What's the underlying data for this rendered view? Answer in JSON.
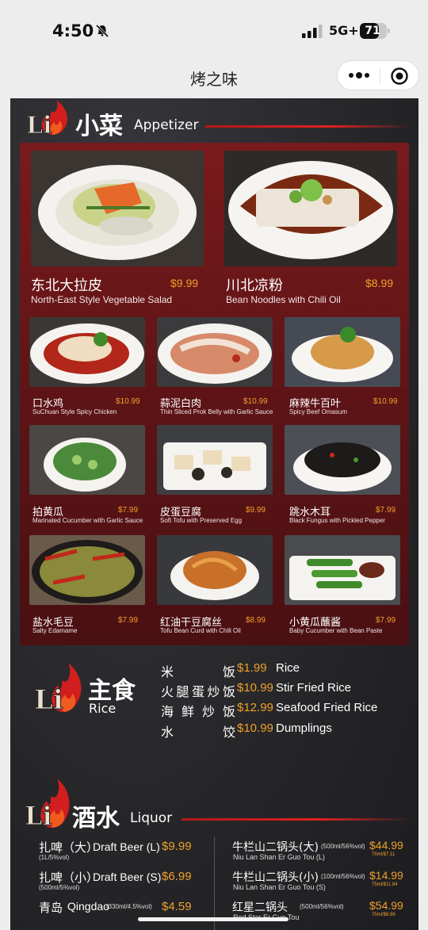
{
  "status_bar": {
    "time": "4:50",
    "network": "5G+",
    "battery": "71"
  },
  "nav": {
    "title": "烤之味"
  },
  "brand": {
    "logo_text": "Li",
    "accent": "#e02020",
    "price_color": "#f0a02a"
  },
  "appetizer": {
    "title_cn": "小菜",
    "title_en": "Appetizer",
    "items": [
      {
        "cn": "东北大拉皮",
        "en": "North-East Style Vegetable Salad",
        "price": "$9.99"
      },
      {
        "cn": "川北凉粉",
        "en": "Bean Noodles with Chili Oil",
        "price": "$8.99"
      },
      {
        "cn": "口水鸡",
        "en": "SuChuan Style Spicy Chicken",
        "price": "$10.99"
      },
      {
        "cn": "蒜泥白肉",
        "en": "Thin Sliced Prok Belly with Garlic Sauce",
        "price": "$10.99"
      },
      {
        "cn": "麻辣牛百叶",
        "en": "Spicy Beef Omasum",
        "price": "$10.99"
      },
      {
        "cn": "拍黄瓜",
        "en": "Marinated Cucumber with Garlic Sauce",
        "price": "$7.99"
      },
      {
        "cn": "皮蛋豆腐",
        "en": "Soft Tofu with Preserved Egg",
        "price": "$9.99"
      },
      {
        "cn": "跳水木耳",
        "en": "Black Fungus with Pickled Pepper",
        "price": "$7.99"
      },
      {
        "cn": "盐水毛豆",
        "en": "Salty Edamame",
        "price": "$7.99"
      },
      {
        "cn": "红油干豆腐丝",
        "en": "Tofu Bean Curd with Chili Oil",
        "price": "$8.99"
      },
      {
        "cn": "小黄瓜蘸酱",
        "en": "Baby Cucumber with Bean Paste",
        "price": "$7.99"
      }
    ]
  },
  "rice": {
    "title_cn": "主食",
    "title_en": "Rice",
    "items": [
      {
        "cn": "米饭",
        "price": "$1.99",
        "en": "Rice"
      },
      {
        "cn": "火腿蛋炒饭",
        "price": "$10.99",
        "en": "Stir Fried Rice"
      },
      {
        "cn": "海鲜炒饭",
        "price": "$12.99",
        "en": "Seafood Fried Rice"
      },
      {
        "cn": "水饺",
        "price": "$10.99",
        "en": "Dumplings"
      }
    ]
  },
  "liquor": {
    "title_cn": "酒水",
    "title_en": "Liquor",
    "left": [
      {
        "cn": "扎啤（大）",
        "en": "Draft Beer (L)",
        "sub": "(1L/5%vol)",
        "price": "$9.99"
      },
      {
        "cn": "扎啤（小）",
        "en": "Draft Beer (S)",
        "sub": "(500ml/5%vol)",
        "price": "$6.99"
      },
      {
        "cn": "青岛",
        "en": "Qingdao",
        "note": "(330ml/4.5%vol)",
        "price": "$4.59"
      }
    ],
    "right": [
      {
        "cn": "牛栏山二锅头(大)",
        "note": "(500ml/56%vol)",
        "sub": "Niu Lan Shan Er Guo Tou (L)",
        "price": "$44.99",
        "small_price": "75ml/$7.11"
      },
      {
        "cn": "牛栏山二锅头(小)",
        "note": "(100ml/56%vol)",
        "sub": "Niu Lan Shan Er Guo Tou (S)",
        "price": "$14.99",
        "small_price": "75ml/$11.84"
      },
      {
        "cn": "红星二锅头",
        "note": "(500ml/56%vol)",
        "sub": "Red Star Er Guo Tou",
        "price": "$54.99",
        "small_price": "75ml/$8.88"
      }
    ]
  }
}
